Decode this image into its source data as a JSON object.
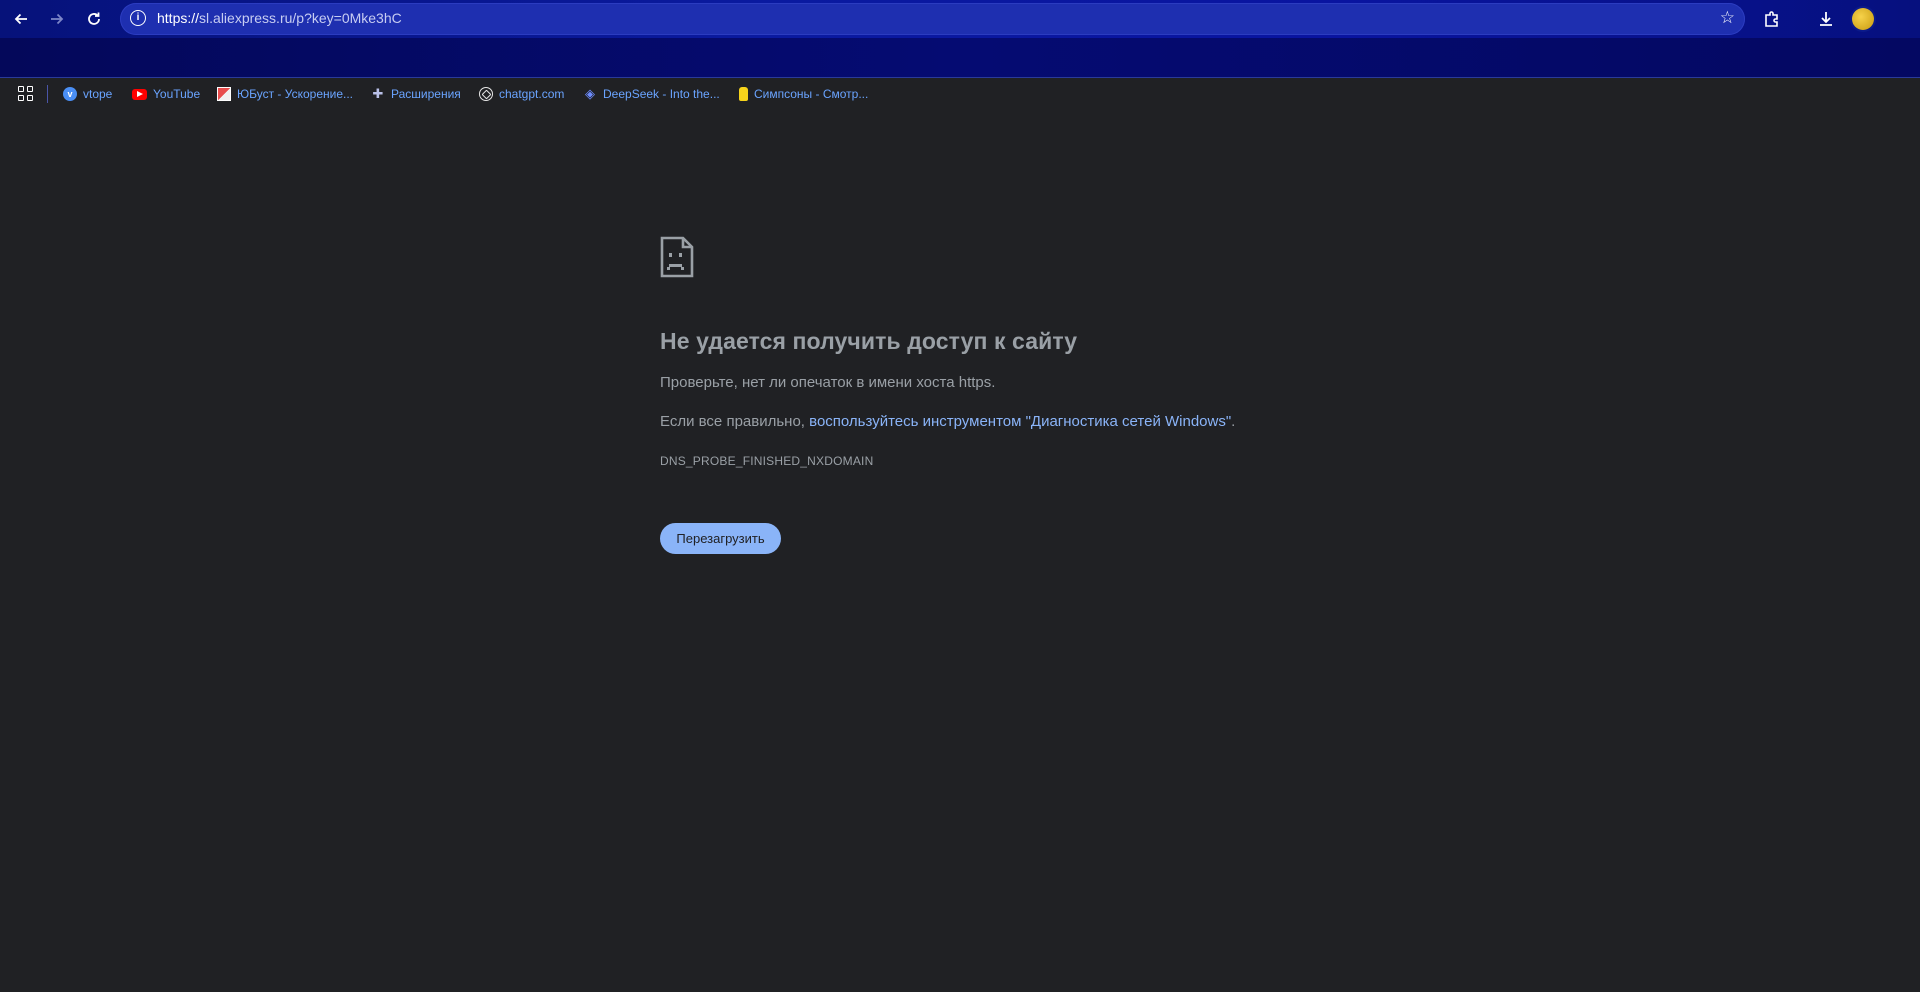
{
  "toolbar": {
    "url_scheme": "https://",
    "url_rest": "sl.aliexpress.ru/p?key=0Mke3hC"
  },
  "bookmarks": [
    {
      "label": "vtope",
      "icon": "vtope-favicon"
    },
    {
      "label": "YouTube",
      "icon": "youtube-favicon"
    },
    {
      "label": "ЮБуст - Ускорение...",
      "icon": "yubust-favicon"
    },
    {
      "label": "Расширения",
      "icon": "puzzle-favicon"
    },
    {
      "label": "chatgpt.com",
      "icon": "chatgpt-favicon"
    },
    {
      "label": "DeepSeek - Into the...",
      "icon": "deepseek-favicon"
    },
    {
      "label": "Симпсоны - Смотр...",
      "icon": "simpsons-favicon"
    }
  ],
  "error": {
    "title": "Не удается получить доступ к сайту",
    "line1": "Проверьте, нет ли опечаток в имени хоста https.",
    "line2_prefix": "Если все правильно, ",
    "line2_link": "воспользуйтесь инструментом \"Диагностика сетей Windows\"",
    "line2_suffix": ".",
    "code": "DNS_PROBE_FINISHED_NXDOMAIN",
    "reload_label": "Перезагрузить"
  },
  "colors": {
    "page_background": "#202124",
    "link": "#8ab4f8",
    "text": "#9aa0a6",
    "toolbar": "#0a1aa0"
  }
}
